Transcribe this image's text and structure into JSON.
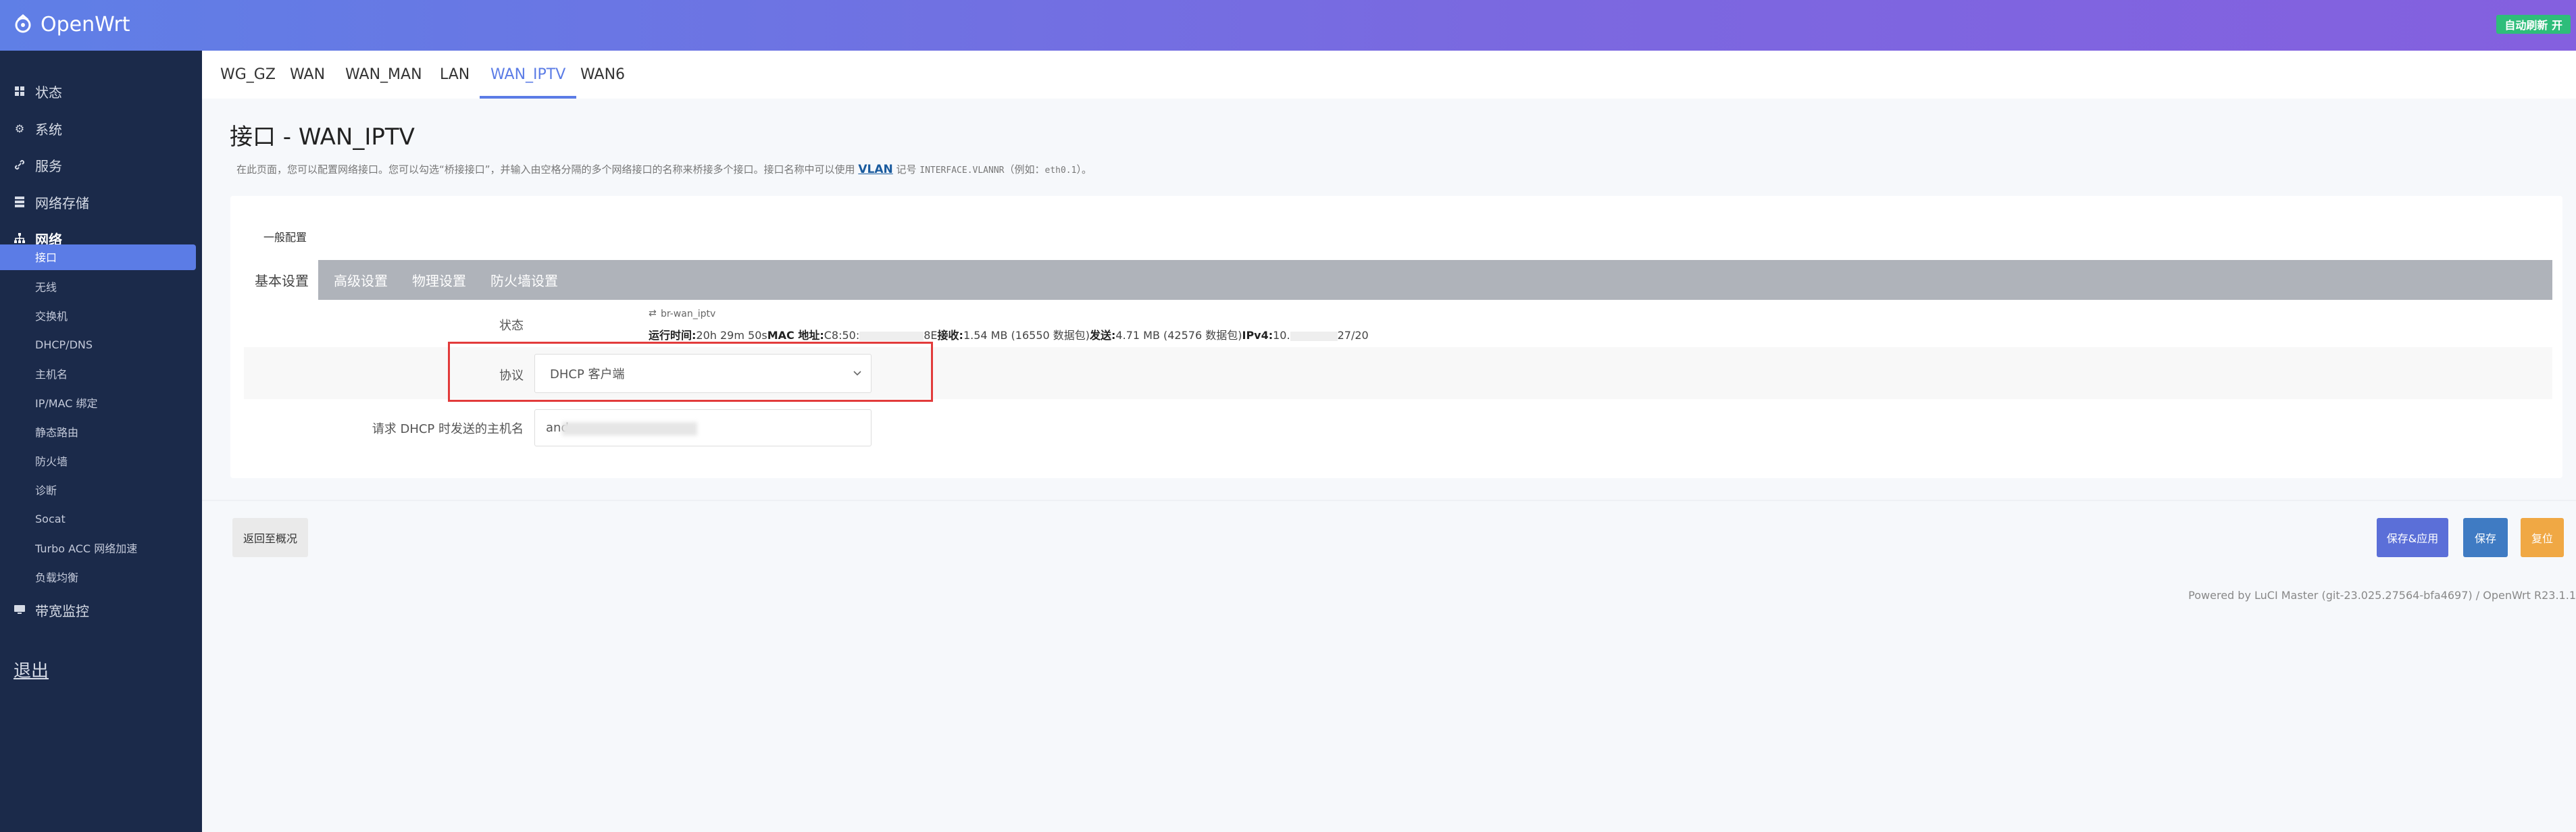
{
  "header": {
    "brand": "OpenWrt",
    "auto_refresh": "自动刷新 开",
    "colors": {
      "gradient_start": "#5f7fe6",
      "gradient_end": "#8460df",
      "refresh_bg": "#2ebd7a"
    }
  },
  "sidebar": {
    "items": [
      {
        "icon": "dashboard-icon",
        "label": "状态"
      },
      {
        "icon": "gear-icon",
        "label": "系统"
      },
      {
        "icon": "link-icon",
        "label": "服务"
      },
      {
        "icon": "storage-icon",
        "label": "网络存储"
      },
      {
        "icon": "network-icon",
        "label": "网络"
      }
    ],
    "network_subitems": [
      "接口",
      "无线",
      "交换机",
      "DHCP/DNS",
      "主机名",
      "IP/MAC 绑定",
      "静态路由",
      "防火墙",
      "诊断",
      "Socat",
      "Turbo ACC 网络加速",
      "负载均衡"
    ],
    "bandwidth": {
      "icon": "monitor-icon",
      "label": "带宽监控"
    },
    "logout": "退出",
    "colors": {
      "bg": "#1b2a4a",
      "selected": "#5b7ce6"
    }
  },
  "tabs": [
    "WG_GZ",
    "WAN",
    "WAN_MAN",
    "LAN",
    "WAN_IPTV",
    "WAN6"
  ],
  "active_tab": "WAN_IPTV",
  "page": {
    "title": "接口 - WAN_IPTV",
    "desc_prefix": "在此页面，您可以配置网络接口。您可以勾选“桥接接口”，并输入由空格分隔的多个网络接口的名称来桥接多个接口。接口名称中可以使用 ",
    "desc_link": "VLAN",
    "desc_mid": " 记号 ",
    "desc_code": "INTERFACE.VLANNR",
    "desc_mid2": "（例如：",
    "desc_code2": "eth0.1",
    "desc_suffix": "）。"
  },
  "form": {
    "section_title": "一般配置",
    "subtabs": [
      "基本设置",
      "高级设置",
      "物理设置",
      "防火墙设置"
    ],
    "status_label": "状态",
    "status_interface": "br-wan_iptv",
    "status": {
      "uptime_label": "运行时间:",
      "uptime": "20h 29m 50s",
      "mac_label": "MAC 地址:",
      "mac_prefix": "C8:50:",
      "mac_suffix": "8E",
      "rx_label": "接收:",
      "rx": "1.54 MB (16550 数据包)",
      "tx_label": "发送:",
      "tx": "4.71 MB (42576 数据包)",
      "ipv4_label": "IPv4:",
      "ipv4_prefix": "10.",
      "ipv4_suffix": "27/20"
    },
    "protocol_label": "协议",
    "protocol_value": "DHCP 客户端",
    "hostname_label": "请求 DHCP 时发送的主机名",
    "hostname_value": "and"
  },
  "actions": {
    "back": "返回至概况",
    "save_apply": "保存&应用",
    "save": "保存",
    "reset": "复位"
  },
  "footer": "Powered by LuCI Master (git-23.025.27564-bfa4697) / OpenWrt R23.1.1"
}
